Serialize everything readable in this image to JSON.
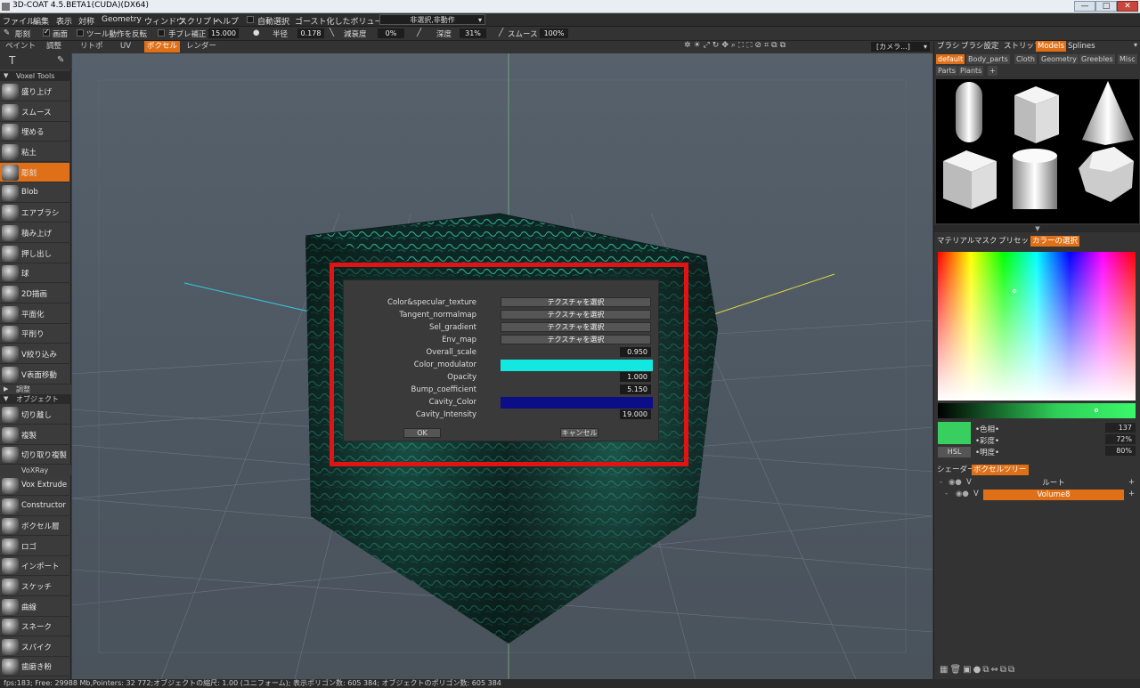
{
  "window": {
    "title": "3D-COAT 4.5.BETA1(CUDA)(DX64)",
    "minimize": "—",
    "maximize": "□",
    "close": "✕"
  },
  "menu": {
    "items": [
      "ファイル",
      "編集",
      "表示",
      "対称",
      "Geometry",
      "ウィンドウ",
      "スクリプト",
      "ヘルプ"
    ],
    "auto_select": "自動選択",
    "ghost_volume": "ゴースト化したボリューム:",
    "ghost_value": "非選択,非動作"
  },
  "toolbar": {
    "sculpt": "彫刻",
    "screen": "画面",
    "invert_tool": "ツール動作を反転",
    "stabilizer": "手ブレ補正",
    "stabilizer_val": "15.000",
    "radius": "半径",
    "radius_val": "0.178",
    "falloff": "減衰度",
    "falloff_val": "0%",
    "depth": "深度",
    "depth_val": "31%",
    "smooth": "スムース",
    "smooth_val": "100%"
  },
  "room_tabs": [
    "ペイント",
    "調整",
    "リトポ",
    "UV",
    "ボクセル",
    "レンダー"
  ],
  "active_room": "ボクセル",
  "camera_label": "[カメラ...]",
  "left_panel": {
    "header": "Voxel Tools",
    "tools": [
      "盛り上げ",
      "スムース",
      "埋める",
      "粘土",
      "彫刻",
      "Blob",
      "エアブラシ",
      "積み上げ",
      "押し出し",
      "球",
      "2D描画",
      "平面化",
      "平削り",
      "V絞り込み",
      "V表面移動"
    ],
    "section_adjust": "調整",
    "section_objects": "オブジェクト",
    "objects": [
      "切り離し",
      "複製",
      "切り取り複製"
    ],
    "section_voxray": "VoXRay",
    "vox_tools": [
      "Vox Extrude",
      "Constructor",
      "ボクセル層",
      "ロゴ",
      "インポート",
      "スケッチ",
      "曲線",
      "スネーク",
      "スパイク",
      "歯磨き粉"
    ]
  },
  "dialog": {
    "rows": [
      {
        "label": "Color&specular_texture",
        "type": "button",
        "value": "テクスチャを選択"
      },
      {
        "label": "Tangent_normalmap",
        "type": "button",
        "value": "テクスチャを選択"
      },
      {
        "label": "Sel_gradient",
        "type": "button",
        "value": "テクスチャを選択"
      },
      {
        "label": "Env_map",
        "type": "button",
        "value": "テクスチャを選択"
      },
      {
        "label": "Overall_scale",
        "type": "number",
        "value": "0.950"
      },
      {
        "label": "Color_modulator",
        "type": "color",
        "value": "#12e8e0"
      },
      {
        "label": "Opacity",
        "type": "number",
        "value": "1.000"
      },
      {
        "label": "Bump_coefficient",
        "type": "number",
        "value": "5.150"
      },
      {
        "label": "Cavity_Color",
        "type": "color",
        "value": "#0c0e88"
      },
      {
        "label": "Cavity_Intensity",
        "type": "number",
        "value": "19.000"
      }
    ],
    "ok": "OK",
    "cancel": "キャンセル"
  },
  "right_panel": {
    "top_tabs": [
      "ブラシ",
      "ブラシ設定",
      "ストリップ",
      "Models",
      "Splines"
    ],
    "active_top_tab": "Models",
    "categories": [
      "default",
      "Body_parts",
      "Cloth",
      "Geometry",
      "Greebles",
      "Misc",
      "Parts",
      "Plants"
    ],
    "mid_tabs": [
      "マテリアル",
      "マスク",
      "プリセット",
      "カラーの選択"
    ],
    "active_mid_tab": "カラーの選択",
    "color": {
      "hue_label": "色相",
      "hue": "137",
      "sat_label": "彩度",
      "sat": "72%",
      "light_label": "明度",
      "light": "80%",
      "mode": "HSL",
      "current": "#38cf60"
    },
    "tree_tabs": [
      "シェーダー",
      "ボクセルツリー"
    ],
    "active_tree_tab": "ボクセルツリー",
    "tree": [
      {
        "name": "ルート"
      },
      {
        "name": "Volume8"
      }
    ]
  },
  "status": "fps:183;    Free: 29988 Mb,Pointers: 32 772;オブジェクトの縮尺: 1.00 (ユニフォーム); 表示ポリゴン数: 605 384; オブジェクトのポリゴン数: 605 384"
}
